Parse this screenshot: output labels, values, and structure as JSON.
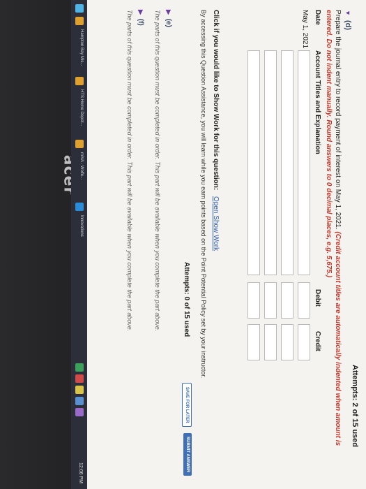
{
  "monitor": {
    "brand": "acer"
  },
  "top_attempts": "Attempts: 2 of 15 used",
  "part_d": {
    "label": "(d)",
    "prompt": "Prepare the journal entry to record payment of interest on May 1, 2021.",
    "instruction": "(Credit account titles are automatically indented when amount is entered. Do not indent manually. Round answers to 0 decimal places, e.g. 5,675.)",
    "headers": {
      "date": "Date",
      "account": "Account Titles and Explanation",
      "debit": "Debit",
      "credit": "Credit"
    },
    "date_value": "May 1, 2021"
  },
  "show_work": {
    "question": "Click if you would like to Show Work for this question:",
    "link": "Open Show Work"
  },
  "assistance_text": "By accessing this Question Assistance, you will learn while you earn points based on the Point Potential Policy set by your instructor.",
  "mid_attempts": "Attempts: 0 of 15 used",
  "buttons": {
    "save_later": "SAVE FOR LATER",
    "submit": "SUBMIT ANSWER"
  },
  "part_e": {
    "label": "(e)",
    "text": "The parts of this question must be completed in order. This part will be available when you complete the part above."
  },
  "part_f": {
    "label": "(f)",
    "text": "The parts of this question must be completed in order. This part will be available when you complete the part above."
  },
  "taskbar": {
    "items": [
      "Hampton Bay Mis...",
      "HTS Home Depot...",
      "miVA - Wolfe...",
      "Innovations"
    ],
    "clock": "12:06 PM"
  }
}
